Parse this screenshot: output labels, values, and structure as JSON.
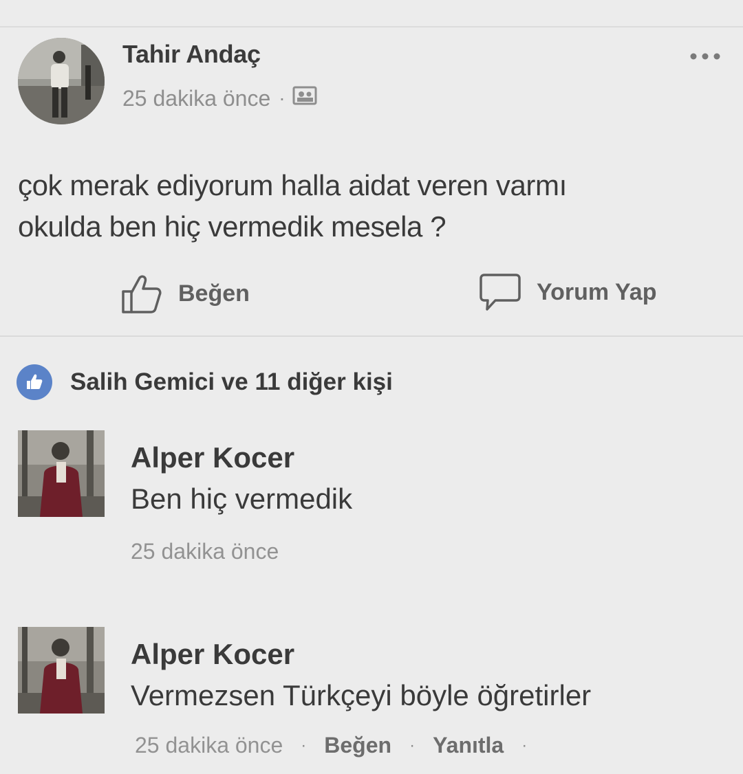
{
  "post": {
    "author": "Tahir Andaç",
    "time": "25 dakika önce",
    "meta_separator": "·",
    "text_line1": "çok merak ediyorum halla aidat veren varmı",
    "text_line2": "okulda ben hiç vermedik mesela ?",
    "privacy_icon": "friends-icon",
    "menu_icon": "more-options-icon"
  },
  "actions": {
    "like_label": "Beğen",
    "comment_label": "Yorum Yap"
  },
  "reactions": {
    "summary": "Salih Gemici ve 11 diğer kişi"
  },
  "comments": [
    {
      "author": "Alper Kocer",
      "text": "Ben hiç vermedik",
      "time": "25 dakika önce"
    },
    {
      "author": "Alper Kocer",
      "text": "Vermezsen Türkçeyi böyle öğretirler",
      "time": "25 dakika önce",
      "separator": "·",
      "like_label": "Beğen",
      "reply_label": "Yanıtla"
    }
  ],
  "colors": {
    "background": "#ececec",
    "like_badge": "#5b83c8",
    "text": "#3a3a3a",
    "meta": "#8e8e8e"
  }
}
